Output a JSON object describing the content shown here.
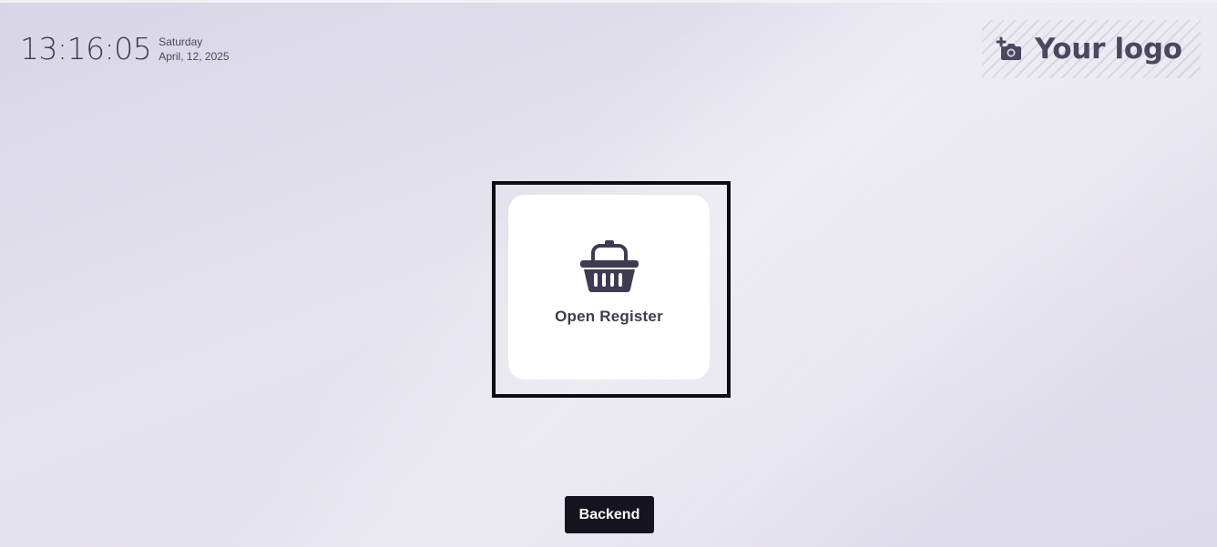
{
  "clock": {
    "time": "13:16:05",
    "weekday": "Saturday",
    "date": "April, 12, 2025"
  },
  "logo": {
    "text": "Your logo",
    "icon": "camera-add-icon"
  },
  "register": {
    "label": "Open Register",
    "icon": "basket-icon"
  },
  "footer": {
    "backend_label": "Backend"
  },
  "colors": {
    "background": "#dcd9e9",
    "text": "#3d3a52",
    "button_bg": "#15141e",
    "card_bg": "#ffffff"
  }
}
